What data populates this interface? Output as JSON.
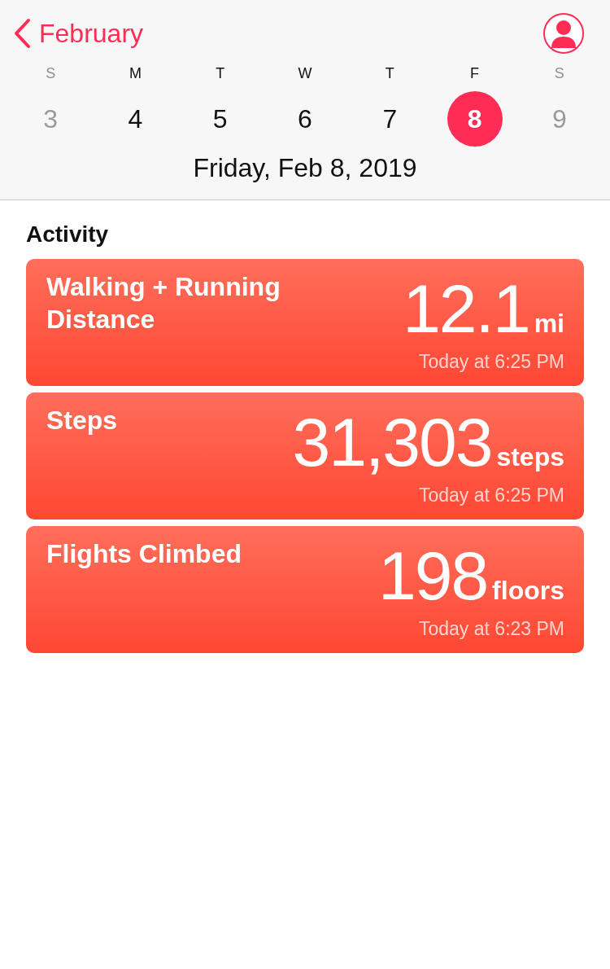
{
  "nav": {
    "back_label": "February"
  },
  "week": [
    {
      "letter": "S",
      "day": "3",
      "selected": false,
      "dimmed": true
    },
    {
      "letter": "M",
      "day": "4",
      "selected": false,
      "dimmed": false
    },
    {
      "letter": "T",
      "day": "5",
      "selected": false,
      "dimmed": false
    },
    {
      "letter": "W",
      "day": "6",
      "selected": false,
      "dimmed": false
    },
    {
      "letter": "T",
      "day": "7",
      "selected": false,
      "dimmed": false
    },
    {
      "letter": "F",
      "day": "8",
      "selected": true,
      "dimmed": false
    },
    {
      "letter": "S",
      "day": "9",
      "selected": false,
      "dimmed": true
    }
  ],
  "date_title": "Friday, Feb 8, 2019",
  "section_title": "Activity",
  "cards": [
    {
      "title": "Walking + Running Distance",
      "value": "12.1",
      "unit": "mi",
      "time": "Today at 6:25 PM"
    },
    {
      "title": "Steps",
      "value": "31,303",
      "unit": "steps",
      "time": "Today at 6:25 PM"
    },
    {
      "title": "Flights Climbed",
      "value": "198",
      "unit": "floors",
      "time": "Today at 6:23 PM"
    }
  ]
}
